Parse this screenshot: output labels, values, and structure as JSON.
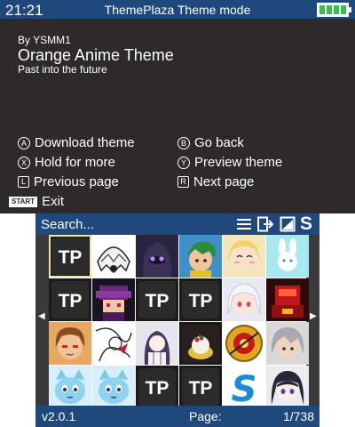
{
  "status": {
    "time": "21:21",
    "title": "ThemePlaza Theme mode",
    "battery_level": 1.0
  },
  "theme": {
    "author": "By YSMM1",
    "name": "Orange Anime Theme",
    "description": "Past into the future"
  },
  "controls": {
    "download": {
      "button": "A",
      "label": "Download theme"
    },
    "go_back": {
      "button": "B",
      "label": "Go back"
    },
    "hold": {
      "button": "X",
      "label": "Hold for more"
    },
    "preview": {
      "button": "Y",
      "label": "Preview theme"
    },
    "prev_page": {
      "button": "L",
      "label": "Previous page"
    },
    "next_page": {
      "button": "R",
      "label": "Next page"
    },
    "exit": {
      "button": "START",
      "label": "Exit"
    }
  },
  "search": {
    "placeholder": "Search...",
    "icons": [
      "menu-icon",
      "export-icon",
      "image-icon",
      "sort-icon"
    ],
    "sort_letter": "S"
  },
  "grid": {
    "selected_index": 0,
    "tp_text": "TP",
    "items": [
      "tp-logo",
      "white-ghost-anime",
      "purple-hooded-figure",
      "green-hair-boy",
      "blonde-girl-smile",
      "blue-bunny-on-teal",
      "tp-logo",
      "pixel-art-purple-sprite",
      "tp-logo",
      "tp-logo",
      "white-hair-anime-girl",
      "red-pixel-robot",
      "brown-hair-boy-red-eyes",
      "manga-sketch",
      "gothic-lolita-girl",
      "christmas-pudding",
      "guns-n-roses-logo",
      "gray-hair-anime-boy",
      "blue-cat-creature",
      "blue-cat-creature",
      "tp-logo",
      "tp-logo",
      "blue-s-logo",
      "dark-hair-anime-girl"
    ]
  },
  "footer": {
    "version": "v2.0.1",
    "page_label": "Page:",
    "page_value": "1/738"
  },
  "colors": {
    "bar_blue": "#1f497d",
    "top_bg": "#2d2a29",
    "battery_green": "#34c04a",
    "selection": "#f0e2a0"
  }
}
